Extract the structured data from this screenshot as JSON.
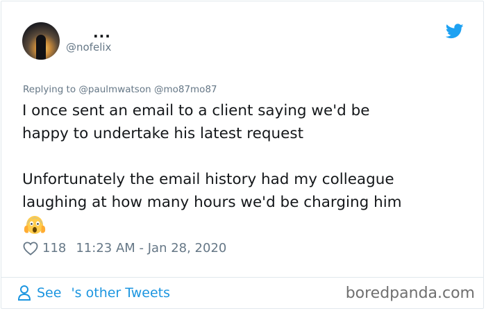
{
  "header": {
    "display_name": "...",
    "handle": "@nofelix",
    "avatar_icon": "avatar-image",
    "brand_icon": "twitter-bird-icon",
    "brand_color": "#1da1f2"
  },
  "tweet": {
    "reply_to": "Replying to @paulmwatson @mo87mo87",
    "line1": "I once sent an email to a client saying we'd be",
    "line2": "happy to undertake his latest request",
    "line3": "Unfortunately the email history had my colleague",
    "line4": "laughing at how many hours we'd be charging him",
    "emoji_icon": "face-screaming-in-fear-icon"
  },
  "meta": {
    "heart_icon": "heart-outline-icon",
    "likes": "118",
    "timestamp": "11:23 AM - Jan 28, 2020"
  },
  "footer": {
    "see_prefix": "See",
    "see_suffix": "'s other Tweets",
    "user_icon": "user-outline-icon",
    "link_color": "#1b95e0",
    "watermark": "boredpanda.com"
  }
}
